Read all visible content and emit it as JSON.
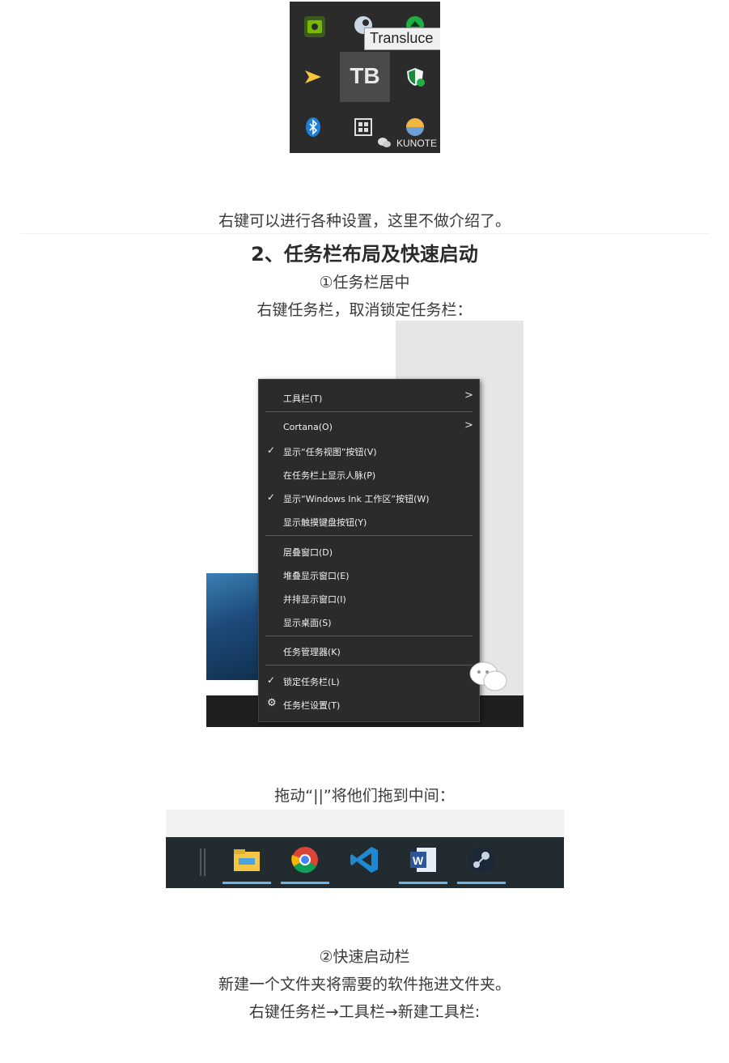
{
  "tray": {
    "tooltip": "Transluce",
    "sel_icon_label": "TB",
    "kunote_label": "KUNOTE"
  },
  "texts": {
    "p1": "右键可以进行各种设置，这里不做介绍了。",
    "heading": "2、任务栏布局及快速启动",
    "sub1": "①任务栏居中",
    "p2": "右键任务栏，取消锁定任务栏：",
    "p3": "拖动“||”将他们拖到中间：",
    "sub2": "②快速启动栏",
    "p4": "新建一个文件夹将需要的软件拖进文件夹。",
    "p5": "右键任务栏→工具栏→新建工具栏:"
  },
  "context_menu": {
    "items": [
      {
        "label": "工具栏(T)",
        "checked": false,
        "submenu": true
      },
      {
        "label": "Cortana(O)",
        "checked": false,
        "submenu": true
      },
      {
        "label": "显示“任务视图”按钮(V)",
        "checked": true,
        "submenu": false
      },
      {
        "label": "在任务栏上显示人脉(P)",
        "checked": false,
        "submenu": false
      },
      {
        "label": "显示“Windows Ink 工作区”按钮(W)",
        "checked": true,
        "submenu": false
      },
      {
        "label": "显示触摸键盘按钮(Y)",
        "checked": false,
        "submenu": false
      },
      {
        "label": "层叠窗口(D)",
        "checked": false,
        "submenu": false
      },
      {
        "label": "堆叠显示窗口(E)",
        "checked": false,
        "submenu": false
      },
      {
        "label": "并排显示窗口(I)",
        "checked": false,
        "submenu": false
      },
      {
        "label": "显示桌面(S)",
        "checked": false,
        "submenu": false
      },
      {
        "label": "任务管理器(K)",
        "checked": false,
        "submenu": false
      },
      {
        "label": "锁定任务栏(L)",
        "checked": true,
        "submenu": false
      },
      {
        "label": "任务栏设置(T)",
        "checked": false,
        "submenu": false
      }
    ],
    "check_glyph": "✓",
    "arrow_glyph": ">",
    "gear_glyph": "⚙"
  },
  "dock": {
    "apps": [
      "file-explorer-icon",
      "chrome-icon",
      "vscode-icon",
      "word-icon",
      "steam-icon"
    ]
  },
  "colors": {
    "tray_bg": "#2b2b2b",
    "menu_bg": "#2b2b2b",
    "taskbar_bg": "#222b30",
    "app_underline": "#6fb3e8"
  }
}
